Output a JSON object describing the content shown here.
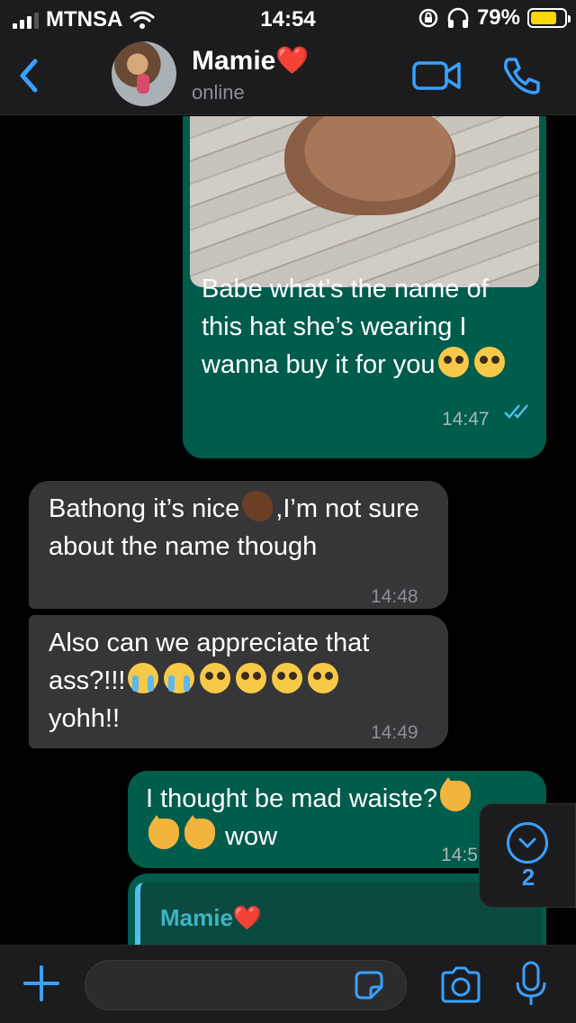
{
  "status_bar": {
    "carrier": "MTNSA",
    "time": "14:54",
    "battery_pct": "79%",
    "battery_level": 0.79,
    "icons": [
      "signal-icon",
      "wifi-icon",
      "rotation-lock-icon",
      "headphones-icon",
      "battery-icon"
    ]
  },
  "header": {
    "contact_name": "Mamie❤️",
    "status": "online",
    "icons": [
      "back-chevron-icon",
      "avatar",
      "video-call-icon",
      "phone-call-icon"
    ]
  },
  "messages": [
    {
      "direction": "outgoing",
      "has_photo": true,
      "text": "Babe what’s the name of this hat she’s wearing I wanna buy it for you",
      "emojis": [
        "pleading-face",
        "pleading-face"
      ],
      "time": "14:47",
      "read": true
    },
    {
      "direction": "incoming",
      "text_before": "Bathong it’s nice",
      "emoji": "pinched-fingers-dark-skin",
      "text_after": ",I’m not sure about the name though",
      "time": "14:48"
    },
    {
      "direction": "incoming",
      "text_before": "Also can we appreciate that ass?!!!",
      "emojis": [
        "loudly-crying-face",
        "loudly-crying-face",
        "pleading-face",
        "pleading-face",
        "pleading-face",
        "pleading-face"
      ],
      "text_after": "yohh!!",
      "time": "14:49"
    },
    {
      "direction": "outgoing",
      "text_before": "I thought be mad waiste?",
      "emojis": [
        "cat-tears-of-joy",
        "cat-tears-of-joy",
        "cat-tears-of-joy"
      ],
      "text_after": "wow",
      "time": "14:5"
    },
    {
      "direction": "outgoing",
      "reply_to_name": "Mamie❤️",
      "partial": true
    }
  ],
  "scroll_down": {
    "unread_count": "2",
    "icon": "chevron-down-circle-icon"
  },
  "input_bar": {
    "placeholder": "",
    "icons": [
      "plus-icon",
      "sticker-icon",
      "camera-icon",
      "microphone-icon"
    ]
  },
  "colors": {
    "accent": "#3aa0ff",
    "outgoing_bubble": "#005c4b",
    "incoming_bubble": "#363638",
    "read_ticks": "#53bdeb",
    "battery": "#ffd60a"
  }
}
